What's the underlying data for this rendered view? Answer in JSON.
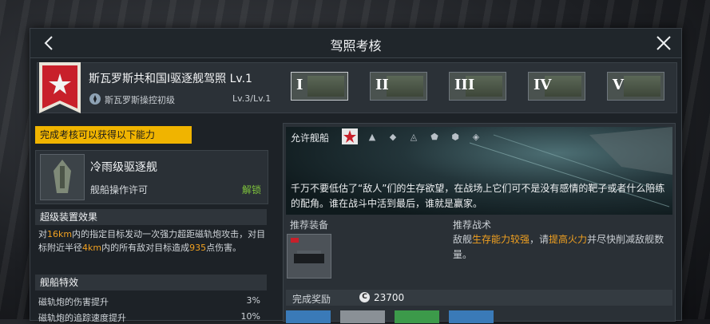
{
  "window": {
    "title": "驾照考核"
  },
  "header": {
    "ship_title": "斯瓦罗斯共和国I驱逐舰驾照 Lv.1",
    "rank": "斯瓦罗斯操控初级",
    "level": "Lv.3/Lv.1",
    "tiers": [
      "I",
      "II",
      "III",
      "IV",
      "V"
    ]
  },
  "ability": {
    "header": "完成考核可以获得以下能力",
    "ship_name": "冷雨级驱逐舰",
    "permit": "舰船操作许可",
    "unlock": "解锁",
    "super_title": "超级装置效果",
    "super_parts": [
      {
        "t": "对",
        "hl": false
      },
      {
        "t": "16km",
        "hl": true
      },
      {
        "t": "内的指定目标发动一次强力超距磁轨炮攻击，对目标附近半径",
        "hl": false
      },
      {
        "t": "4km",
        "hl": true
      },
      {
        "t": "内的所有敌对目标造成",
        "hl": false
      },
      {
        "t": "935",
        "hl": true
      },
      {
        "t": "点伤害。",
        "hl": false
      }
    ],
    "trait_title": "舰船特效",
    "traits": [
      {
        "name": "磁轨炮的伤害提升",
        "value": "3%"
      },
      {
        "name": "磁轨炮的追踪速度提升",
        "value": "10%"
      }
    ]
  },
  "detail": {
    "allow_label": "允许舰船",
    "quote": "千万不要低估了“敌人”们的生存欲望，在战场上它们可不是没有感情的靶子或者什么陪练的配角。谁在战斗中活到最后，谁就是赢家。",
    "equip_label": "推荐装备",
    "tactic_label": "推荐战术",
    "tactic_parts": [
      {
        "t": "敌舰",
        "hl": false
      },
      {
        "t": "生存能力较强",
        "hl": true
      },
      {
        "t": "，请",
        "hl": false
      },
      {
        "t": "提高火力",
        "hl": true
      },
      {
        "t": "并尽快削减敌舰数量。",
        "hl": false
      }
    ],
    "reward_label": "完成奖励",
    "coin_glyph": "C",
    "reward_value": "23700"
  },
  "colors": {
    "accent": "#f0b400",
    "highlight": "#f0a020",
    "unlock": "#7fc43c",
    "ribbon_red": "#c8202a"
  }
}
